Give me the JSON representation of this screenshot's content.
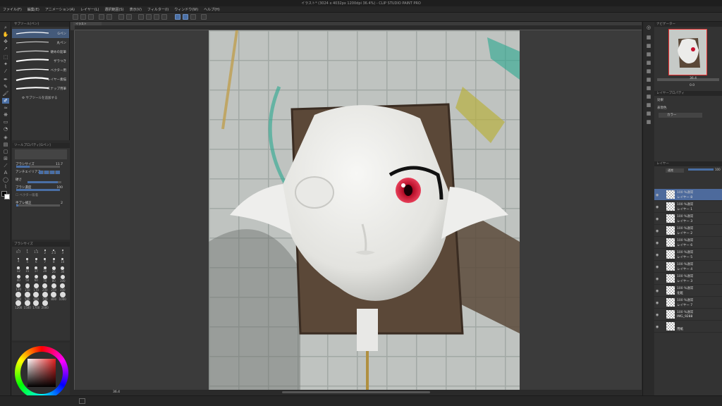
{
  "window": {
    "title": "イラスト* (3024 x 4032px 1200dpi 36.4%) - CLIP STUDIO PAINT PRO"
  },
  "menu": [
    "ファイル(F)",
    "編集(E)",
    "アニメーション(A)",
    "レイヤー(L)",
    "選択範囲(S)",
    "表示(V)",
    "フィルター(I)",
    "ウィンドウ(W)",
    "ヘルプ(H)"
  ],
  "subtool": {
    "tab": "サブツール[ペン]",
    "brushes": [
      {
        "label": "Gペン",
        "selected": true
      },
      {
        "label": "丸ペン",
        "selected": false
      },
      {
        "label": "硬めの鉛筆",
        "selected": false
      },
      {
        "label": "ザラつき",
        "selected": false
      },
      {
        "label": "ベクター用",
        "selected": false
      },
      {
        "label": "レイヤー素描",
        "selected": false
      },
      {
        "label": "スナップ用筆",
        "selected": false
      }
    ],
    "add_label": "サブツールを追加する"
  },
  "toolprop": {
    "tab": "ツールプロパティ[Gペン]",
    "rows": [
      {
        "label": "ブラシサイズ",
        "value": "11.7"
      },
      {
        "label": "アンチエイリアス",
        "value": ""
      },
      {
        "label": "硬さ",
        "value": ""
      },
      {
        "label": "ブラシ濃度",
        "value": "100"
      },
      {
        "label": "ベクター吸着",
        "value": ""
      },
      {
        "label": "手ブレ補正",
        "value": "2"
      }
    ]
  },
  "brushsize": {
    "tab": "ブラシサイズ",
    "sizes": [
      "0.7",
      "1",
      "1.5",
      "2",
      "2.5",
      "3",
      "4",
      "5",
      "6",
      "7",
      "8",
      "10",
      "12",
      "15",
      "17",
      "20",
      "25",
      "30",
      "40",
      "50",
      "60",
      "70",
      "80",
      "100",
      "120",
      "150",
      "170",
      "200",
      "250",
      "300",
      "400",
      "500",
      "600",
      "700",
      "800",
      "1000",
      "1200",
      "1500",
      "1700",
      "2000"
    ]
  },
  "colors": {
    "main": "#e62020",
    "accent": "#4a6fa5"
  },
  "canvas": {
    "zoom": "36.4",
    "tab": "イラスト"
  },
  "navigator": {
    "tab": "ナビゲーター",
    "zoom": "36.4",
    "angle": "0.0"
  },
  "layerprop": {
    "tab": "レイヤープロパティ",
    "effect_label": "効果",
    "expr_label": "表現色",
    "expr_value": "カラー"
  },
  "layers": {
    "tab": "レイヤー",
    "blend": "通常",
    "opacity": "100",
    "items": [
      {
        "mode": "100 %通常",
        "name": "レイヤー 8",
        "selected": true
      },
      {
        "mode": "100 %通常",
        "name": "レイヤー 1",
        "selected": false
      },
      {
        "mode": "100 %通常",
        "name": "レイヤー 3",
        "selected": false
      },
      {
        "mode": "100 %通常",
        "name": "レイヤー 2",
        "selected": false
      },
      {
        "mode": "100 %通常",
        "name": "レイヤー 6",
        "selected": false
      },
      {
        "mode": "100 %通常",
        "name": "レイヤー 5",
        "selected": false
      },
      {
        "mode": "100 %通常",
        "name": "レイヤー 4",
        "selected": false
      },
      {
        "mode": "100 %通常",
        "name": "レイヤー 3",
        "selected": false
      },
      {
        "mode": "100 %通常",
        "name": "化粧",
        "selected": false
      },
      {
        "mode": "100 %通常",
        "name": "レイヤー 7",
        "selected": false
      },
      {
        "mode": "100 %通常",
        "name": "IMG_9288",
        "selected": false
      },
      {
        "mode": "",
        "name": "用紙",
        "selected": false
      }
    ]
  }
}
